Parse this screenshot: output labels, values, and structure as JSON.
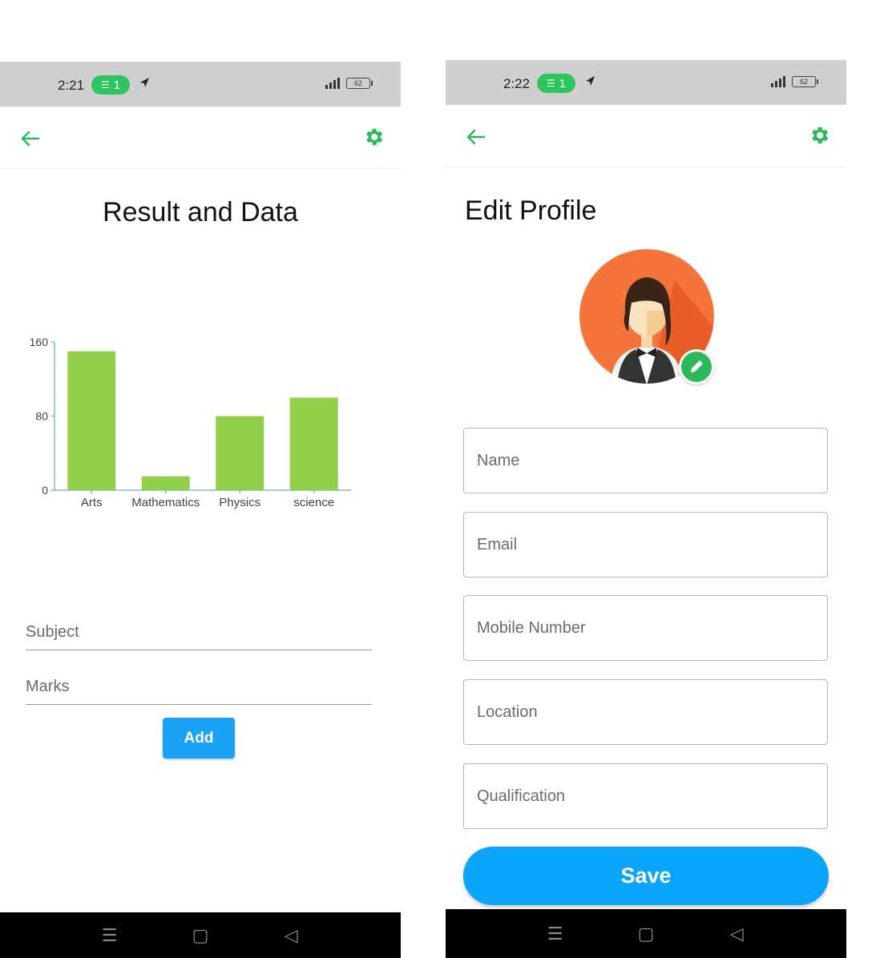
{
  "left": {
    "status": {
      "time": "2:21",
      "pill_count": "1",
      "battery": "62"
    },
    "title": "Result and Data",
    "subject_placeholder": "Subject",
    "marks_placeholder": "Marks",
    "add_label": "Add",
    "nav": {
      "menu": "☰",
      "home": "▢",
      "back": "◁"
    }
  },
  "right": {
    "status": {
      "time": "2:22",
      "pill_count": "1",
      "battery": "62"
    },
    "title": "Edit Profile",
    "fields": {
      "name": "Name",
      "email": "Email",
      "mobile": "Mobile Number",
      "location": "Location",
      "qualification": "Qualification"
    },
    "save_label": "Save",
    "nav": {
      "menu": "☰",
      "home": "▢",
      "back": "◁"
    }
  },
  "colors": {
    "accent_green": "#2eb85c",
    "bar_green": "#93d04a",
    "button_blue": "#0aa5fb",
    "axis_blue": "#7db7e3",
    "status_bg": "#cfcfcf",
    "avatar_orange": "#f5743a"
  },
  "icons": [
    "back-arrow-icon",
    "gear-icon",
    "pencil-icon",
    "wifi-icon",
    "navigation-arrow-icon",
    "signal-icon",
    "battery-icon"
  ],
  "chart_data": {
    "type": "bar",
    "categories": [
      "Arts",
      "Mathematics",
      "Physics",
      "science"
    ],
    "values": [
      150,
      15,
      80,
      100
    ],
    "yticks": [
      "0",
      "80",
      "160"
    ],
    "ylim": [
      0,
      160
    ],
    "title": "",
    "xlabel": "",
    "ylabel": "",
    "grid": false,
    "legend": "none"
  }
}
